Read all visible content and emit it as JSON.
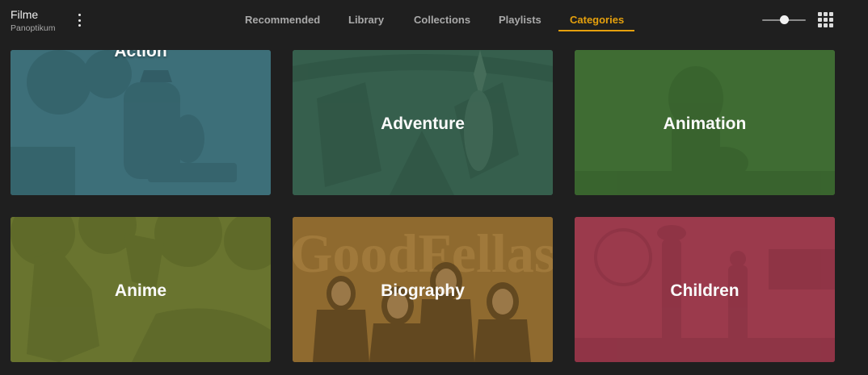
{
  "library": {
    "name": "Filme",
    "server": "Panoptikum"
  },
  "tabs": [
    {
      "label": "Recommended",
      "active": false
    },
    {
      "label": "Library",
      "active": false
    },
    {
      "label": "Collections",
      "active": false
    },
    {
      "label": "Playlists",
      "active": false
    },
    {
      "label": "Categories",
      "active": true
    }
  ],
  "toolbar": {
    "size_slider_value": 0.5,
    "view_mode_icon": "grid-icon"
  },
  "colors": {
    "accent": "#e5a00d",
    "background": "#1f1f1f",
    "tab_inactive": "#a9a9a9"
  },
  "categories": [
    {
      "label": "Action",
      "color": "#3d6f79"
    },
    {
      "label": "Adventure",
      "color": "#365f4d"
    },
    {
      "label": "Animation",
      "color": "#3f6c33"
    },
    {
      "label": "Anime",
      "color": "#69742f"
    },
    {
      "label": "Biography",
      "color": "#8f6a2f",
      "artwork_text": "GoodFellas"
    },
    {
      "label": "Children",
      "color": "#9b3a4c"
    }
  ]
}
